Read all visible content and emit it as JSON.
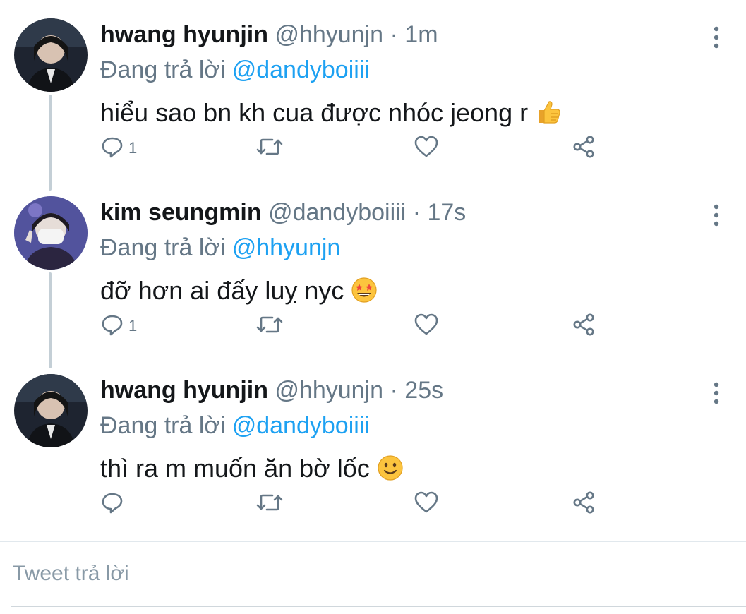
{
  "tweets": [
    {
      "name": "hwang hyunjin",
      "handle": "@hhyunjn",
      "dot": "·",
      "time": "1m",
      "reply_prefix": "Đang trả lời",
      "reply_to": "@dandyboiiii",
      "text": "hiểu sao bn kh cua được nhóc jeong r",
      "emoji": "thumbs-up",
      "reply_count": "1"
    },
    {
      "name": "kim seungmin",
      "handle": "@dandyboiiii",
      "dot": "·",
      "time": "17s",
      "reply_prefix": "Đang trả lời",
      "reply_to": "@hhyunjn",
      "text": "đỡ hơn ai đấy luỵ nyc",
      "emoji": "star-struck-face",
      "reply_count": "1"
    },
    {
      "name": "hwang hyunjin",
      "handle": "@hhyunjn",
      "dot": "·",
      "time": "25s",
      "reply_prefix": "Đang trả lời",
      "reply_to": "@dandyboiiii",
      "text": "thì ra m muốn ăn bờ lốc",
      "emoji": "slightly-smiling-face",
      "reply_count": ""
    }
  ],
  "reply_box": {
    "placeholder": "Tweet trả lời"
  },
  "colors": {
    "accent": "#1da1f2",
    "secondary_text": "#657786",
    "thread_line": "#c4cfd6"
  }
}
